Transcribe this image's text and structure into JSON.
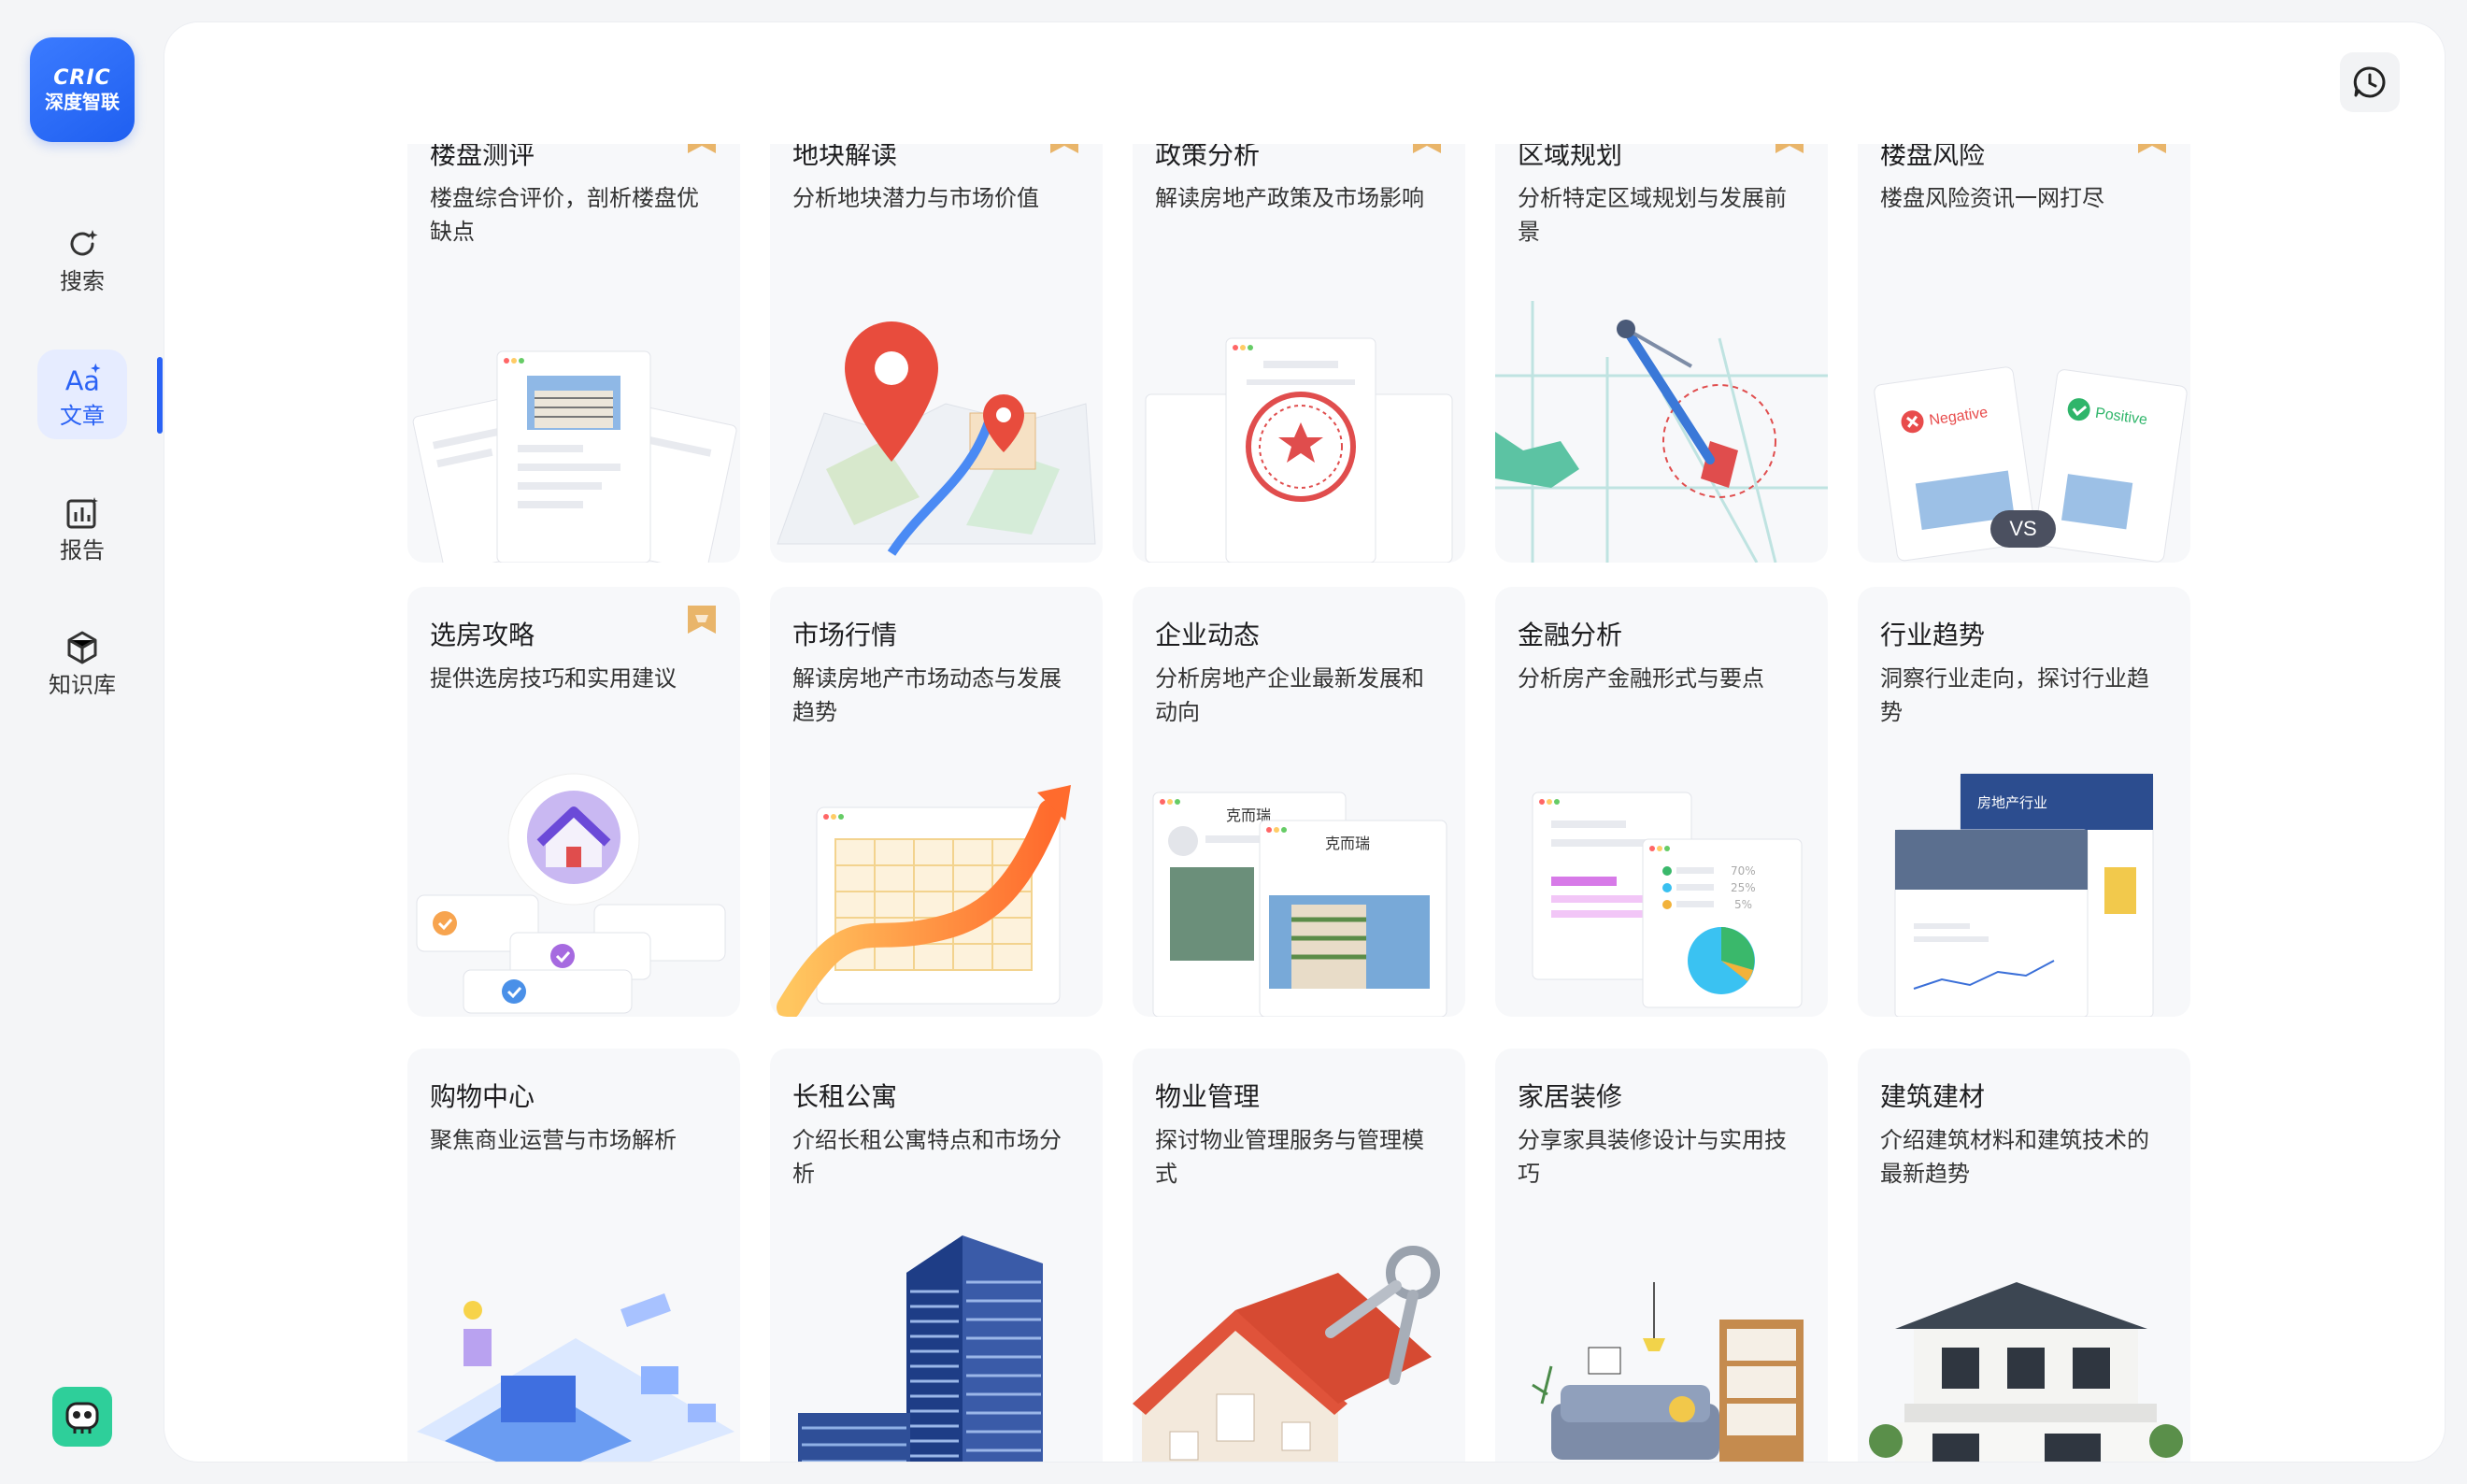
{
  "brand": {
    "logo_en": "CRIC",
    "logo_cn": "深度智联"
  },
  "nav": [
    {
      "label": "搜索",
      "icon": "search-refresh-icon"
    },
    {
      "label": "文章",
      "icon": "text-ai-icon",
      "active": true
    },
    {
      "label": "报告",
      "icon": "report-chart-icon"
    },
    {
      "label": "知识库",
      "icon": "knowledge-cube-icon"
    }
  ],
  "cards": [
    {
      "title": "楼盘测评",
      "desc": "楼盘综合评价，剖析楼盘优缺点",
      "badge": true
    },
    {
      "title": "地块解读",
      "desc": "分析地块潜力与市场价值",
      "badge": true
    },
    {
      "title": "政策分析",
      "desc": "解读房地产政策及市场影响",
      "badge": true
    },
    {
      "title": "区域规划",
      "desc": "分析特定区域规划与发展前景",
      "badge": true
    },
    {
      "title": "楼盘风险",
      "desc": "楼盘风险资讯一网打尽",
      "badge": true
    },
    {
      "title": "选房攻略",
      "desc": "提供选房技巧和实用建议",
      "badge": true
    },
    {
      "title": "市场行情",
      "desc": "解读房地产市场动态与发展趋势",
      "badge": false
    },
    {
      "title": "企业动态",
      "desc": "分析房地产企业最新发展和动向",
      "badge": false
    },
    {
      "title": "金融分析",
      "desc": "分析房产金融形式与要点",
      "badge": false
    },
    {
      "title": "行业趋势",
      "desc": "洞察行业走向，探讨行业趋势",
      "badge": false
    },
    {
      "title": "购物中心",
      "desc": "聚焦商业运营与市场解析",
      "badge": false
    },
    {
      "title": "长租公寓",
      "desc": "介绍长租公寓特点和市场分析",
      "badge": false
    },
    {
      "title": "物业管理",
      "desc": "探讨物业管理服务与管理模式",
      "badge": false
    },
    {
      "title": "家居装修",
      "desc": "分享家具装修设计与实用技巧",
      "badge": false
    },
    {
      "title": "建筑建材",
      "desc": "介绍建筑材料和建筑技术的最新趋势",
      "badge": false
    }
  ],
  "art_text": {
    "negative": "Negative",
    "positive": "Positive",
    "vs": "VS",
    "keruirui": "克而瑞",
    "pct_70": "70%",
    "pct_25": "25%",
    "pct_5": "5%",
    "industry": "房地产行业"
  },
  "colors": {
    "accent": "#2a62f5",
    "badge": "#e9b56a",
    "card_bg": "#f7f8fa"
  }
}
